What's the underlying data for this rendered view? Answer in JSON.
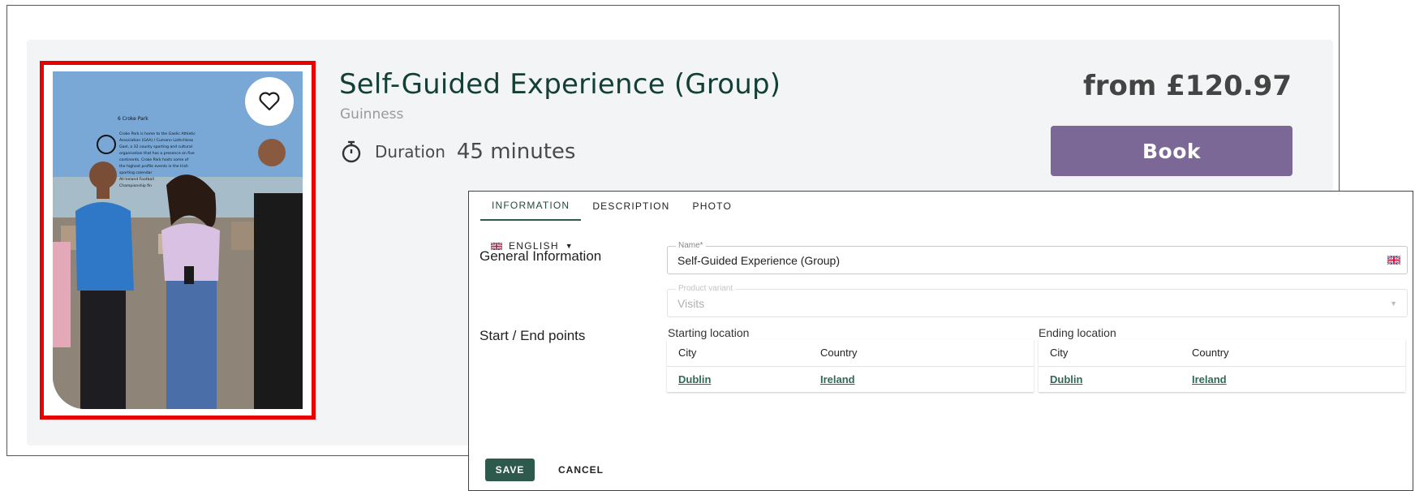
{
  "card": {
    "title": "Self-Guided Experience (Group)",
    "supplier": "Guinness",
    "duration_label": "Duration",
    "duration_value": "45 minutes",
    "price": "from £120.97",
    "book_label": "Book",
    "favorite_icon": "heart-icon",
    "photo_highlight_color": "#e60000",
    "book_color": "#7b6896"
  },
  "panel": {
    "tabs": [
      {
        "label": "INFORMATION",
        "active": true
      },
      {
        "label": "DESCRIPTION",
        "active": false
      },
      {
        "label": "PHOTO",
        "active": false
      }
    ],
    "language": "ENGLISH",
    "general_title": "General Information",
    "name_field": {
      "legend": "Name*",
      "value": "Self-Guided Experience (Group)"
    },
    "variant_field": {
      "legend": "Product variant",
      "value": "Visits"
    },
    "points_title": "Start / End points",
    "starting": {
      "label": "Starting location",
      "headers": [
        "City",
        "Country"
      ],
      "city": "Dublin",
      "country": "Ireland"
    },
    "ending": {
      "label": "Ending location",
      "headers": [
        "City",
        "Country"
      ],
      "city": "Dublin",
      "country": "Ireland"
    },
    "save_label": "SAVE",
    "cancel_label": "CANCEL",
    "accent_color": "#2e5a4e"
  }
}
